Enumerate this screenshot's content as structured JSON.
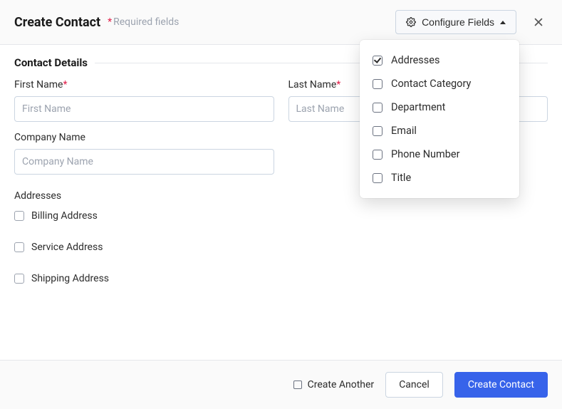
{
  "header": {
    "title": "Create Contact",
    "required_note": "Required fields",
    "configure_label": "Configure Fields"
  },
  "section": {
    "title": "Contact Details"
  },
  "fields": {
    "first_name": {
      "label": "First Name",
      "placeholder": "First Name",
      "value": ""
    },
    "last_name": {
      "label": "Last Name",
      "placeholder": "Last Name",
      "value": ""
    },
    "company_name": {
      "label": "Company Name",
      "placeholder": "Company Name",
      "value": ""
    }
  },
  "addresses": {
    "label": "Addresses",
    "options": [
      {
        "label": "Billing Address",
        "checked": false
      },
      {
        "label": "Service Address",
        "checked": false
      },
      {
        "label": "Shipping Address",
        "checked": false
      }
    ]
  },
  "configure_dropdown": [
    {
      "label": "Addresses",
      "checked": true
    },
    {
      "label": "Contact Category",
      "checked": false
    },
    {
      "label": "Department",
      "checked": false
    },
    {
      "label": "Email",
      "checked": false
    },
    {
      "label": "Phone Number",
      "checked": false
    },
    {
      "label": "Title",
      "checked": false
    }
  ],
  "footer": {
    "create_another": "Create Another",
    "cancel": "Cancel",
    "submit": "Create Contact"
  }
}
